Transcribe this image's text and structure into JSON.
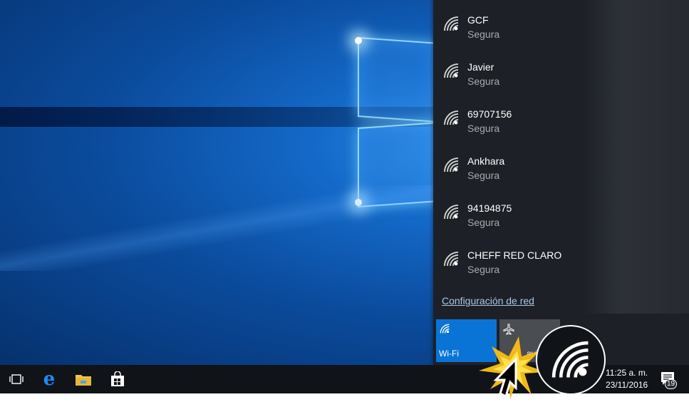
{
  "networks": [
    {
      "name": "GCF",
      "status": "Segura"
    },
    {
      "name": "Javier",
      "status": "Segura"
    },
    {
      "name": "69707156",
      "status": "Segura"
    },
    {
      "name": "Ankhara",
      "status": "Segura"
    },
    {
      "name": "94194875",
      "status": "Segura"
    },
    {
      "name": "CHEFF RED CLARO",
      "status": "Segura"
    }
  ],
  "network_settings_link": "Configuración de red",
  "quick_actions": {
    "wifi_label": "Wi-Fi",
    "airplane_label": "Modo avión",
    "airplane_label_visible": "avi"
  },
  "taskbar": {
    "time": "11:25 a. m.",
    "date": "23/11/2016",
    "notification_count": "19"
  },
  "colors": {
    "accent": "#0a74d6",
    "flyout_bg": "#1d2127",
    "taskbar_bg": "#101418"
  }
}
